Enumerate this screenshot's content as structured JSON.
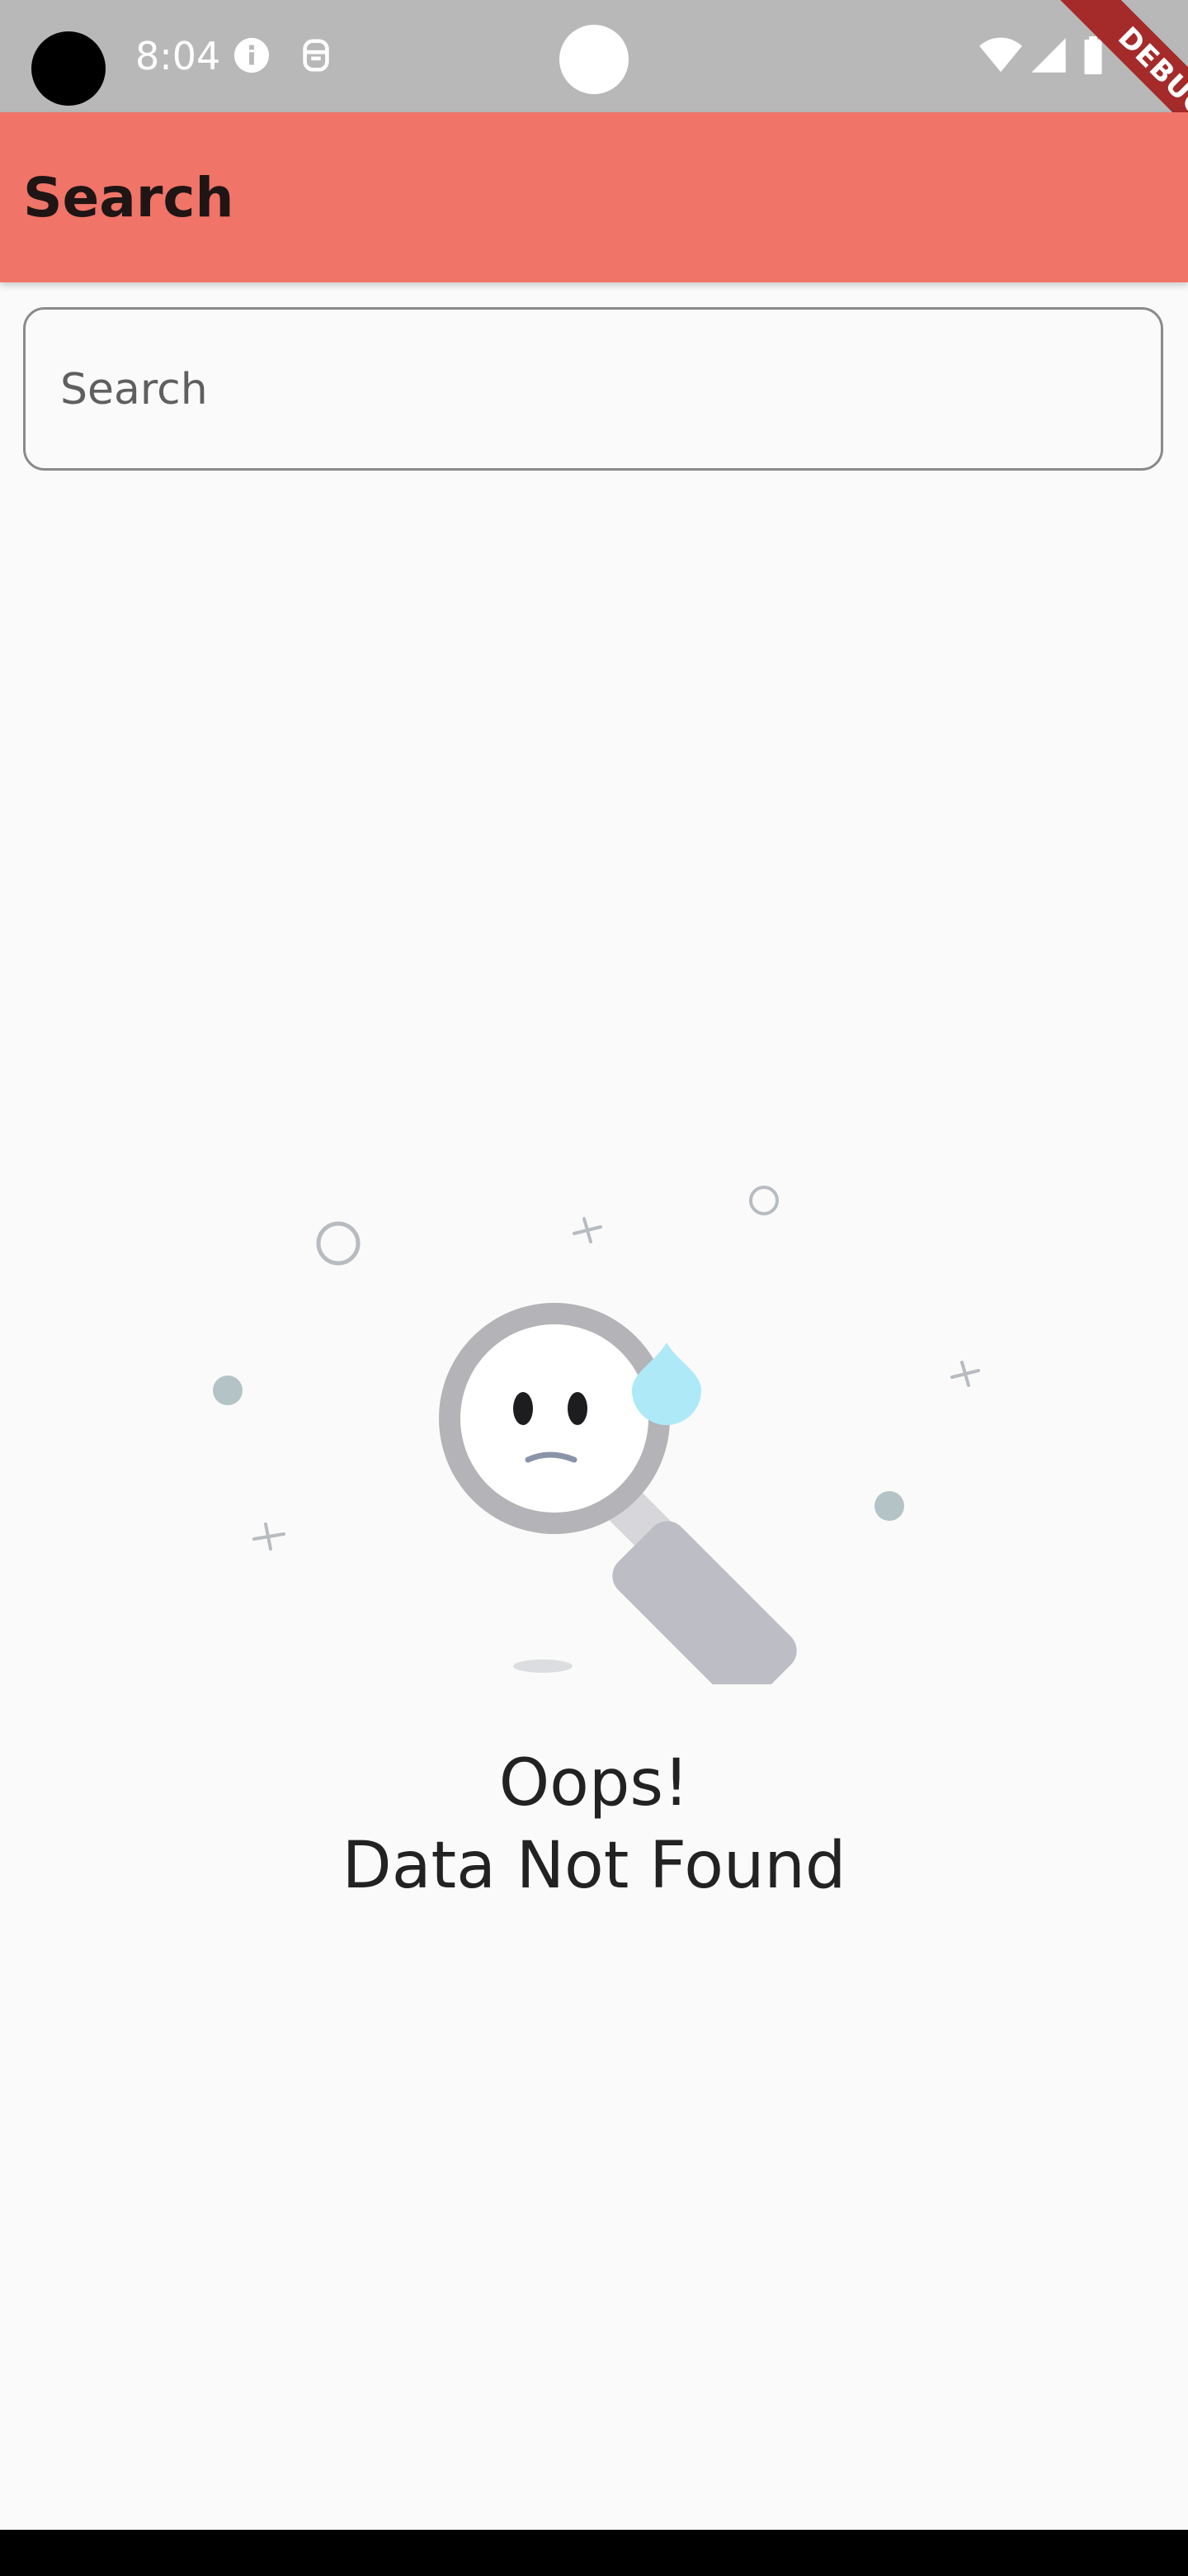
{
  "status_bar": {
    "time": "8:04",
    "icons": [
      "info-icon",
      "notification-icon",
      "wifi-icon",
      "signal-icon",
      "battery-icon"
    ]
  },
  "debug_banner": {
    "label": "DEBUG"
  },
  "app_bar": {
    "title": "Search",
    "color": "#f07468"
  },
  "search": {
    "placeholder": "Search",
    "value": ""
  },
  "empty_state": {
    "line1": "Oops!",
    "line2": "Data Not Found",
    "illustration": "magnifier-sad-face-icon"
  },
  "colors": {
    "status_bar": "#b8b8b8",
    "background": "#fafafa",
    "drop": "#aee9f7",
    "magnifier_rim": "#b3b3b8",
    "handle": "#bdbdc6"
  }
}
